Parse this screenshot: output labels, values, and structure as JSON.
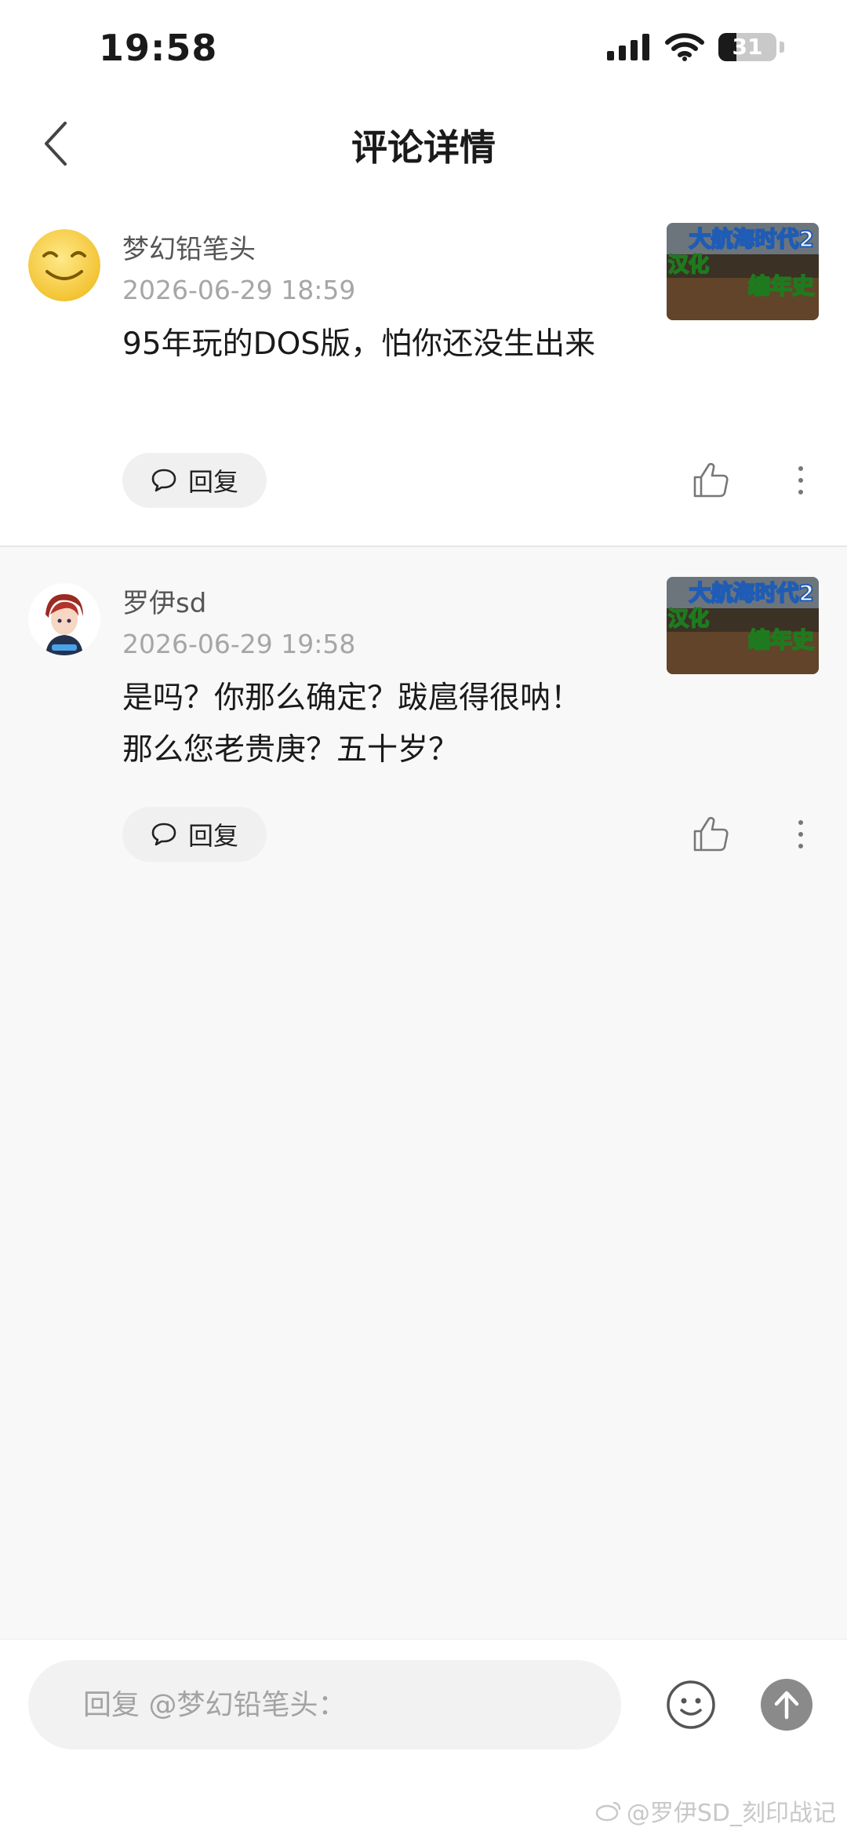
{
  "status_bar": {
    "time": "19:58",
    "battery": "31",
    "battery_level": 0.31
  },
  "nav": {
    "title": "评论详情"
  },
  "comments": [
    {
      "username": "梦幻铅笔头",
      "timestamp": "2026-06-29 18:59",
      "content": "95年玩的DOS版，怕你还没生出来",
      "reply_label": "回复",
      "thumbnail": {
        "line1": "大航海时代2",
        "line2": "汉化",
        "line3": "编年史"
      }
    },
    {
      "username": "罗伊sd",
      "timestamp": "2026-06-29 19:58",
      "content": "是吗？你那么确定？跋扈得很呐！那么您老贵庚？五十岁？",
      "reply_label": "回复",
      "thumbnail": {
        "line1": "大航海时代2",
        "line2": "汉化",
        "line3": "编年史"
      }
    }
  ],
  "bottom": {
    "placeholder": "回复 @梦幻铅笔头："
  },
  "watermark": "@罗伊SD_刻印战记"
}
